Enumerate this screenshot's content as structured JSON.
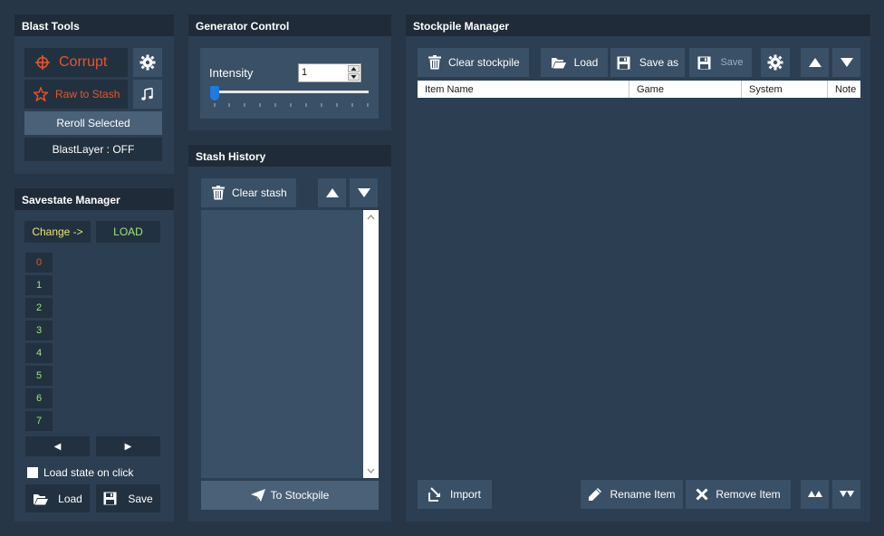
{
  "blast_tools": {
    "title": "Blast Tools",
    "corrupt_label": "Corrupt",
    "raw_to_stash_label": "Raw to Stash",
    "reroll_label": "Reroll Selected",
    "blastlayer_label": "BlastLayer : OFF"
  },
  "generator": {
    "title": "Generator Control",
    "intensity_label": "Intensity",
    "intensity_value": "1",
    "slider_fraction": 0
  },
  "stash": {
    "title": "Stash History",
    "clear_label": "Clear stash",
    "to_stockpile_label": "To Stockpile"
  },
  "savestate": {
    "title": "Savestate Manager",
    "change_label": "Change ->",
    "load_mode_label": "LOAD",
    "slots": [
      "0",
      "1",
      "2",
      "3",
      "4",
      "5",
      "6",
      "7"
    ],
    "prev_label": "◀",
    "next_label": "▶",
    "load_on_click_label": "Load state on click",
    "load_label": "Load",
    "save_label": "Save"
  },
  "stockpile": {
    "title": "Stockpile Manager",
    "clear_label": "Clear stockpile",
    "load_label": "Load",
    "save_as_label": "Save as",
    "save_label": "Save",
    "columns": [
      "Item Name",
      "Game",
      "System",
      "Note"
    ],
    "import_label": "Import",
    "rename_label": "Rename Item",
    "remove_label": "Remove Item"
  },
  "colors": {
    "accent_orange": "#e8542a",
    "accent_green": "#9ee67a",
    "accent_yellow": "#e6e66e",
    "background": "#273647"
  }
}
